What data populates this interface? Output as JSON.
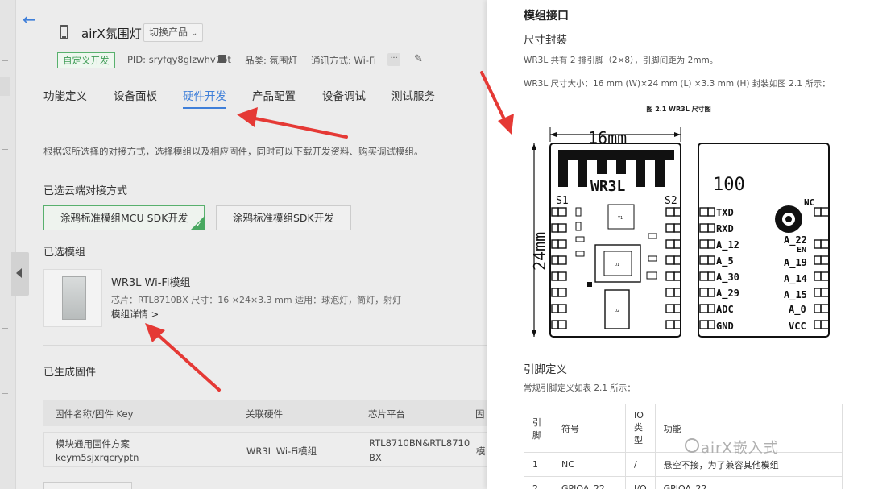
{
  "header": {
    "product_title": "airX氛围灯",
    "switch_label": "切换产品",
    "tag": "自定义开发",
    "pid": "PID: sryfqy8glzwhv7bt",
    "category": "品类: 氛围灯",
    "protocol": "通讯方式: Wi-Fi",
    "more": "···"
  },
  "tabs": [
    {
      "label": "功能定义"
    },
    {
      "label": "设备面板"
    },
    {
      "label": "硬件开发"
    },
    {
      "label": "产品配置"
    },
    {
      "label": "设备调试"
    },
    {
      "label": "测试服务"
    }
  ],
  "hardware": {
    "description": "根据您所选择的对接方式，选择模组以及相应固件，同时可以下载开发资料、购买调试模组。",
    "cloud_label": "已选云端对接方式",
    "option_mcu": "涂鸦标准模组MCU SDK开发",
    "option_sdk": "涂鸦标准模组SDK开发",
    "module_label": "已选模组",
    "module_name": "WR3L Wi-Fi模组",
    "module_spec": "芯片：RTL8710BX   尺寸：16 ×24×3.3 mm   适用：球泡灯，筒灯，射灯",
    "module_link": "模组详情 >",
    "firmware_label": "已生成固件",
    "fw_headers": [
      "固件名称/固件 Key",
      "关联硬件",
      "芯片平台",
      "固"
    ],
    "fw_row": {
      "name": "模块通用固件方案",
      "key": "keym5sjxrqcryptn",
      "hardware": "WR3L Wi-Fi模组",
      "chip1": "RTL8710BN&RTL8710",
      "chip2": "BX",
      "extra": "模"
    }
  },
  "doc": {
    "h1": "模组接口",
    "h2": "尺寸封装",
    "p1": "WR3L 共有 2 排引脚（2×8），引脚间距为 2mm。",
    "p2": "WR3L 尺寸大小：16 mm (W)×24 mm (L) ×3.3 mm (H) 封装如图 2.1 所示：",
    "figure_caption": "图 2.1    WR3L 尺寸图",
    "figure": {
      "width_label": "16mm",
      "height_label": "24mm",
      "module_name": "WR3L",
      "s1": "S1",
      "s2": "S2",
      "chip_u1": "U1",
      "chip_u2": "U2",
      "chip_y1": "Y1",
      "back_number": "100",
      "nc_label": "NC",
      "left_pins": [
        "TXD",
        "RXD",
        "A_12",
        "A_5",
        "A_30",
        "A_29",
        "ADC",
        "GND"
      ],
      "right_pins": [
        "A_22",
        "A_19",
        "A_14",
        "A_15",
        "A_0",
        "VCC"
      ],
      "en_label": "EN"
    },
    "pin_title": "引脚定义",
    "pin_desc": "常规引脚定义如表 2.1 所示：",
    "pin_headers": [
      "引脚",
      "符号",
      "IO类型",
      "功能"
    ],
    "pin_rows": [
      [
        "1",
        "NC",
        "/",
        "悬空不接，为了兼容其他模组"
      ],
      [
        "2",
        "GPIOA_22",
        "I/O",
        "GPIOA_22"
      ]
    ]
  },
  "watermark": "airX嵌入式",
  "colors": {
    "accent": "#3f7fd9",
    "green": "#48a860",
    "annotation": "#e53935"
  }
}
